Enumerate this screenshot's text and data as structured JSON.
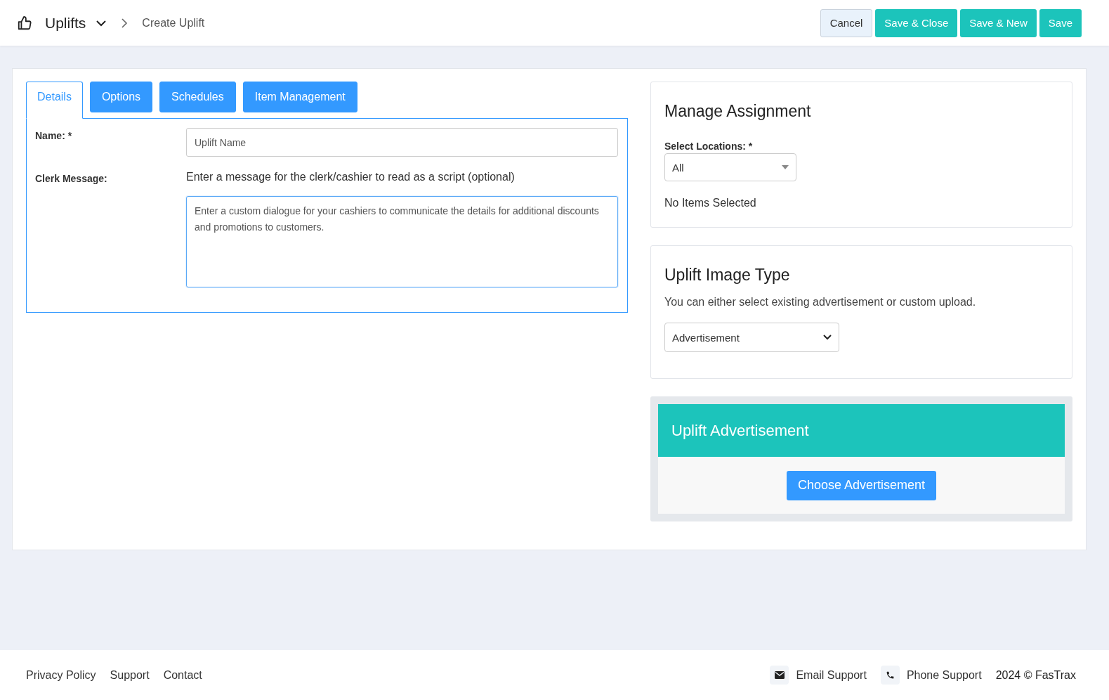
{
  "header": {
    "title": "Uplifts",
    "breadcrumb": "Create Uplift"
  },
  "actions": [
    {
      "label": "Cancel",
      "kind": "secondary"
    },
    {
      "label": "Save & Close",
      "kind": "primary"
    },
    {
      "label": "Save & New",
      "kind": "primary"
    },
    {
      "label": "Save",
      "kind": "primary"
    }
  ],
  "tabs": [
    {
      "label": "Details",
      "selected": true
    },
    {
      "label": "Options",
      "selected": false
    },
    {
      "label": "Schedules",
      "selected": false
    },
    {
      "label": "Item Management",
      "selected": false
    }
  ],
  "form": {
    "name_label": "Name: *",
    "name_placeholder": "Uplift Name",
    "clerk_label": "Clerk Message:",
    "clerk_hint": "Enter a message for the clerk/cashier to read as a script (optional)",
    "clerk_placeholder": "Enter a custom dialogue for your cashiers to communicate the details for additional discounts and promotions to customers."
  },
  "assignment": {
    "title": "Manage Assignment",
    "locations_label": "Select Locations: *",
    "locations_value": "All",
    "empty_text": "No Items Selected"
  },
  "image_type": {
    "title": "Uplift Image Type",
    "description": "You can either select existing advertisement or custom upload.",
    "value": "Advertisement"
  },
  "advertisement": {
    "title": "Uplift Advertisement",
    "button": "Choose Advertisement"
  },
  "footer": {
    "links": [
      "Privacy Policy",
      "Support",
      "Contact"
    ],
    "support": [
      {
        "kind": "email",
        "label": "Email Support"
      },
      {
        "kind": "phone",
        "label": "Phone Support"
      }
    ],
    "copyright": "2024 © FasTrax"
  }
}
